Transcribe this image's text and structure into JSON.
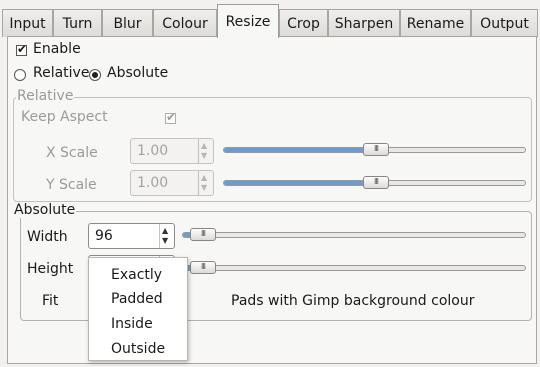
{
  "tabs": [
    {
      "label": "Input"
    },
    {
      "label": "Turn"
    },
    {
      "label": "Blur"
    },
    {
      "label": "Colour"
    },
    {
      "label": "Resize"
    },
    {
      "label": "Crop"
    },
    {
      "label": "Sharpen"
    },
    {
      "label": "Rename"
    },
    {
      "label": "Output"
    }
  ],
  "active_tab": "Resize",
  "enable": {
    "label": "Enable",
    "checked": true
  },
  "mode": {
    "relative_label": "Relative",
    "absolute_label": "Absolute",
    "selected": "Absolute"
  },
  "relative_group": {
    "legend": "Relative",
    "keep_aspect_label": "Keep Aspect",
    "keep_aspect_checked": true,
    "x_scale": {
      "label": "X Scale",
      "value": "1.00"
    },
    "y_scale": {
      "label": "Y Scale",
      "value": "1.00"
    }
  },
  "absolute_group": {
    "legend": "Absolute",
    "width": {
      "label": "Width",
      "value": "96"
    },
    "height": {
      "label": "Height",
      "value": ""
    },
    "fit": {
      "label": "Fit",
      "hint": "Pads with Gimp background colour"
    }
  },
  "fit_menu": {
    "options": [
      "Exactly",
      "Padded",
      "Inside",
      "Outside"
    ]
  },
  "colors": {
    "slider_fill": "#6c9bd2",
    "window_bg": "#f2f1f0"
  }
}
